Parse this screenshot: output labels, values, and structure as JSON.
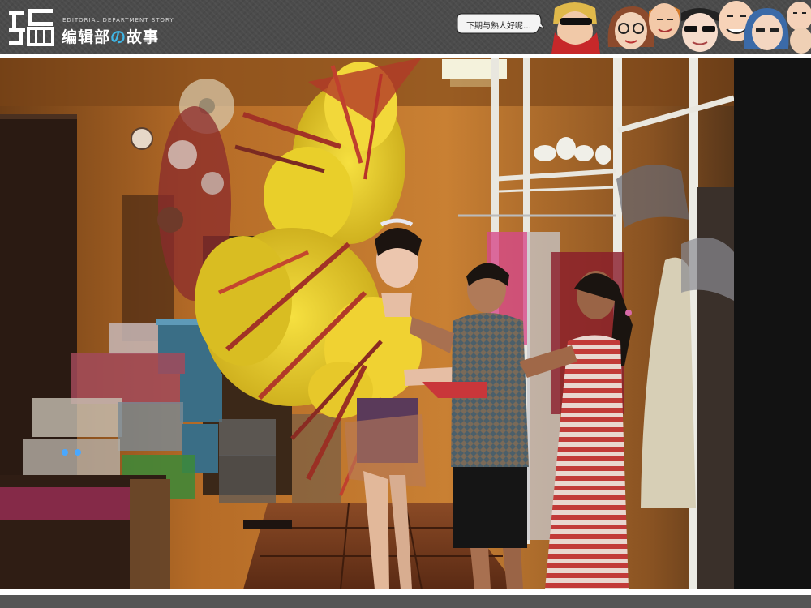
{
  "header": {
    "logo_glyph": "编",
    "logo_subtitle": "EDITORIAL DEPARTMENT STORY",
    "logo_title_part1": "编辑部",
    "logo_title_accent": "の",
    "logo_title_part2": "故事",
    "speech_bubble": "下期与熟人好呢…"
  },
  "colors": {
    "header_bg": "#4b4b4b",
    "accent_blue": "#3fb6e6",
    "feather_yellow": "#f2d62a",
    "feather_red": "#b8322a",
    "wall_orange": "#c0762b"
  },
  "icons": {
    "logo": "logo-mark-icon",
    "speech": "speech-bubble-icon",
    "faces": "cartoon-faces-icon"
  }
}
